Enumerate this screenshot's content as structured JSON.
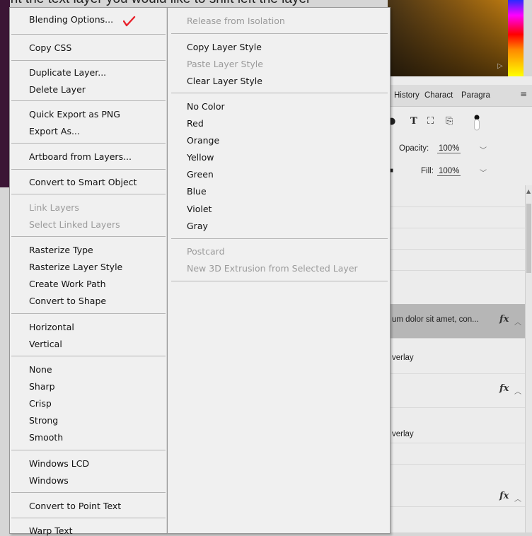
{
  "caption_text": "ight the text layer you would like to shift left the layer",
  "background_panel": {
    "tabs": [
      "History",
      "Charact",
      "Paragra"
    ],
    "tab_menu_icon": "hamburger-icon",
    "tools": [
      "T"
    ],
    "opacity_label": "Opacity:",
    "opacity_value": "100%",
    "fill_label": "Fill:",
    "fill_value": "100%",
    "layers": [
      {
        "text": "um dolor sit amet, con...",
        "fx": "fx"
      },
      {
        "text": "verlay"
      },
      {
        "text": "",
        "fx": "fx"
      },
      {
        "text": "verlay"
      },
      {
        "text": "",
        "fx": "fx"
      }
    ]
  },
  "left_menu": {
    "items": [
      {
        "label": "Blending Options...",
        "disabled": false
      },
      {
        "label": "Copy CSS",
        "disabled": false
      },
      {
        "label": "Duplicate Layer...",
        "disabled": false
      },
      {
        "label": "Delete Layer",
        "disabled": false
      },
      {
        "label": "Quick Export as PNG",
        "disabled": false
      },
      {
        "label": "Export As...",
        "disabled": false
      },
      {
        "label": "Artboard from Layers...",
        "disabled": false
      },
      {
        "label": "Convert to Smart Object",
        "disabled": false
      },
      {
        "label": "Link Layers",
        "disabled": true
      },
      {
        "label": "Select Linked Layers",
        "disabled": true
      },
      {
        "label": "Rasterize Type",
        "disabled": false
      },
      {
        "label": "Rasterize Layer Style",
        "disabled": false
      },
      {
        "label": "Create Work Path",
        "disabled": false
      },
      {
        "label": "Convert to Shape",
        "disabled": false
      },
      {
        "label": "Horizontal",
        "disabled": false
      },
      {
        "label": "Vertical",
        "disabled": false
      },
      {
        "label": "None",
        "disabled": false
      },
      {
        "label": "Sharp",
        "disabled": false
      },
      {
        "label": "Crisp",
        "disabled": false
      },
      {
        "label": "Strong",
        "disabled": false
      },
      {
        "label": "Smooth",
        "disabled": false
      },
      {
        "label": "Windows LCD",
        "disabled": false
      },
      {
        "label": "Windows",
        "disabled": false
      },
      {
        "label": "Convert to Point Text",
        "disabled": false
      },
      {
        "label": "Warp Text",
        "disabled": false
      }
    ]
  },
  "right_menu": {
    "items": [
      {
        "label": "Release from Isolation",
        "disabled": true
      },
      {
        "label": "Copy Layer Style",
        "disabled": false
      },
      {
        "label": "Paste Layer Style",
        "disabled": true
      },
      {
        "label": "Clear Layer Style",
        "disabled": false
      },
      {
        "label": "No Color",
        "disabled": false
      },
      {
        "label": "Red",
        "disabled": false
      },
      {
        "label": "Orange",
        "disabled": false
      },
      {
        "label": "Yellow",
        "disabled": false
      },
      {
        "label": "Green",
        "disabled": false
      },
      {
        "label": "Blue",
        "disabled": false
      },
      {
        "label": "Violet",
        "disabled": false
      },
      {
        "label": "Gray",
        "disabled": false
      },
      {
        "label": "Postcard",
        "disabled": true
      },
      {
        "label": "New 3D Extrusion from Selected Layer",
        "disabled": true
      }
    ]
  },
  "colors": {
    "menu_bg": "#f0f0f0",
    "disabled_text": "#9b9b9b",
    "check_mark": "#e8202a",
    "selected_layer": "#b6b6b6"
  }
}
